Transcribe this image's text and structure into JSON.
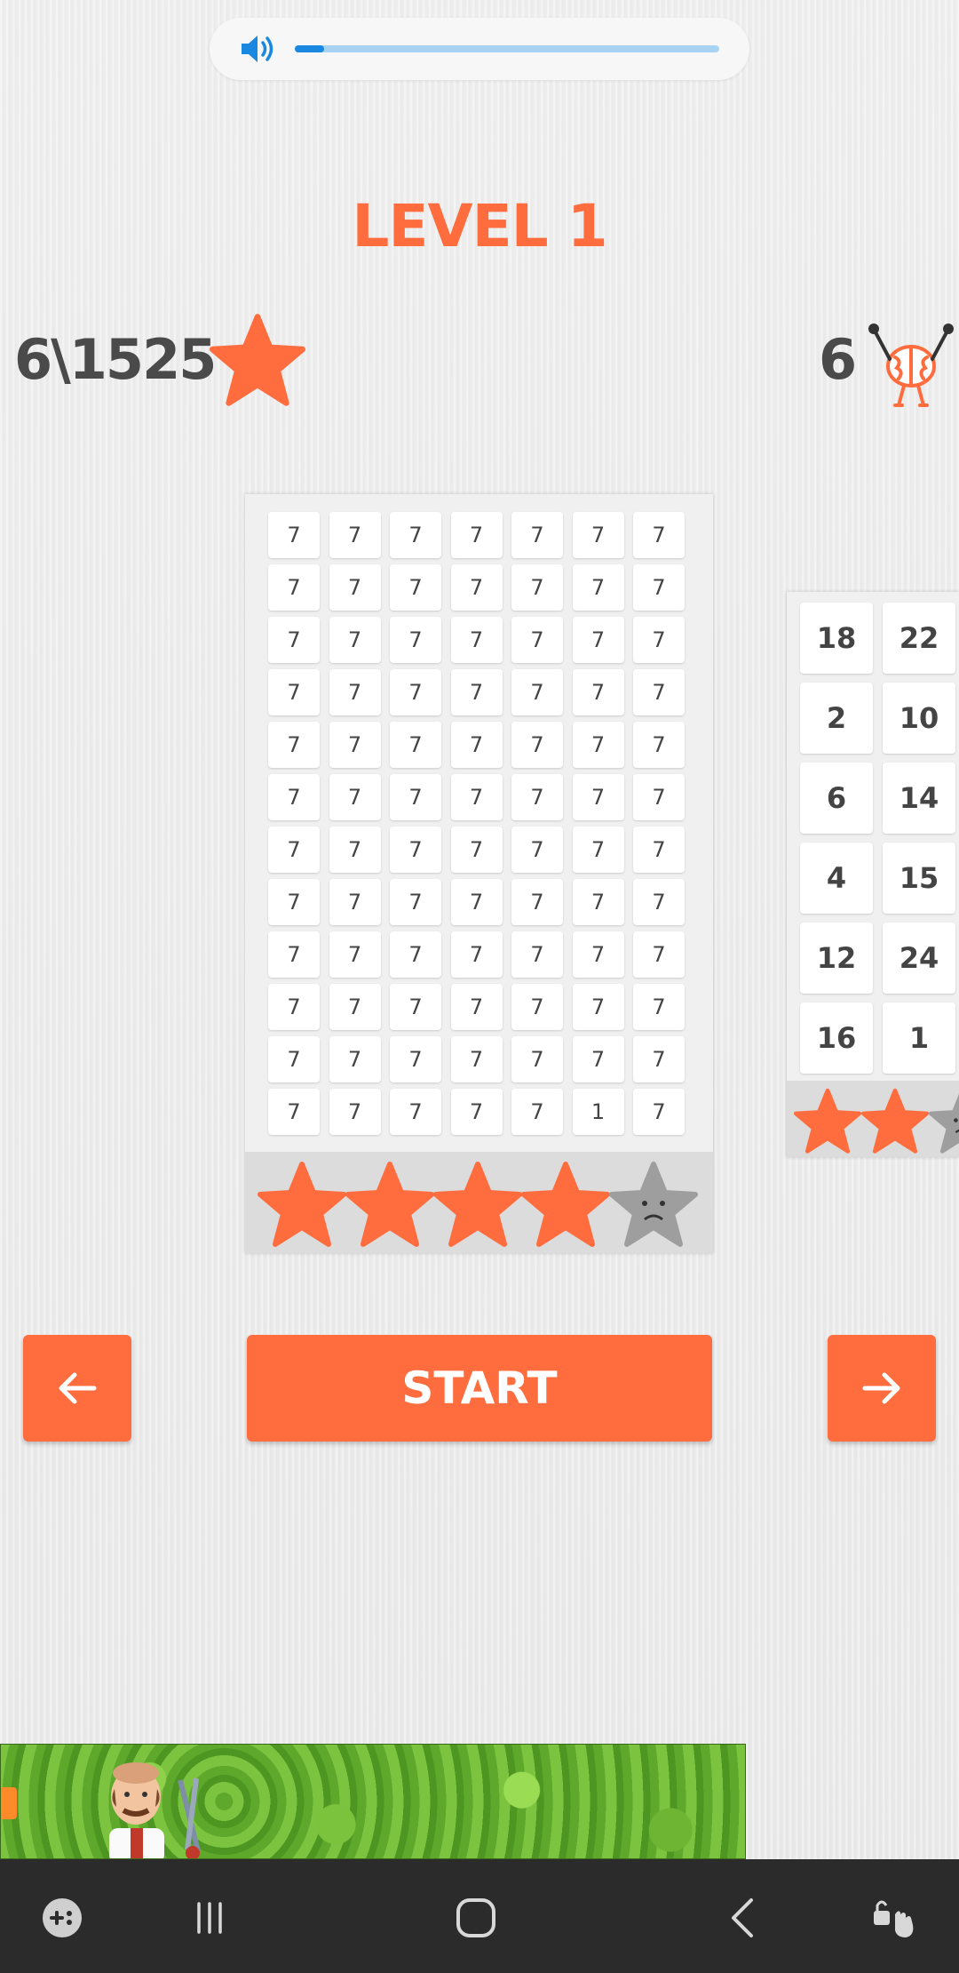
{
  "volume": {
    "level": 0.07,
    "track_color": "#a9d3f2",
    "fill_color": "#1a88e0"
  },
  "level": {
    "title": "LEVEL 1"
  },
  "stats": {
    "stars_progress": "6\\1525",
    "brain_count": "6"
  },
  "level_card": {
    "rows": [
      [
        "7",
        "7",
        "7",
        "7",
        "7",
        "7",
        "7"
      ],
      [
        "7",
        "7",
        "7",
        "7",
        "7",
        "7",
        "7"
      ],
      [
        "7",
        "7",
        "7",
        "7",
        "7",
        "7",
        "7"
      ],
      [
        "7",
        "7",
        "7",
        "7",
        "7",
        "7",
        "7"
      ],
      [
        "7",
        "7",
        "7",
        "7",
        "7",
        "7",
        "7"
      ],
      [
        "7",
        "7",
        "7",
        "7",
        "7",
        "7",
        "7"
      ],
      [
        "7",
        "7",
        "7",
        "7",
        "7",
        "7",
        "7"
      ],
      [
        "7",
        "7",
        "7",
        "7",
        "7",
        "7",
        "7"
      ],
      [
        "7",
        "7",
        "7",
        "7",
        "7",
        "7",
        "7"
      ],
      [
        "7",
        "7",
        "7",
        "7",
        "7",
        "7",
        "7"
      ],
      [
        "7",
        "7",
        "7",
        "7",
        "7",
        "7",
        "7"
      ],
      [
        "7",
        "7",
        "7",
        "7",
        "7",
        "1",
        "7"
      ]
    ],
    "stars_earned": 4,
    "stars_total": 5
  },
  "next_card": {
    "rows": [
      [
        "18",
        "22"
      ],
      [
        "2",
        "10"
      ],
      [
        "6",
        "14"
      ],
      [
        "4",
        "15"
      ],
      [
        "12",
        "24"
      ],
      [
        "16",
        "1"
      ]
    ],
    "stars_shown": [
      "full",
      "full",
      "empty"
    ]
  },
  "buttons": {
    "start_label": "START"
  },
  "colors": {
    "accent": "#ff6d3f",
    "star_empty": "#9e9e9e",
    "nav_bg": "#2b2b2b"
  },
  "navbar": {
    "icons": [
      "game-launcher-icon",
      "recent-apps-icon",
      "home-icon",
      "back-icon",
      "accessibility-icon"
    ]
  }
}
